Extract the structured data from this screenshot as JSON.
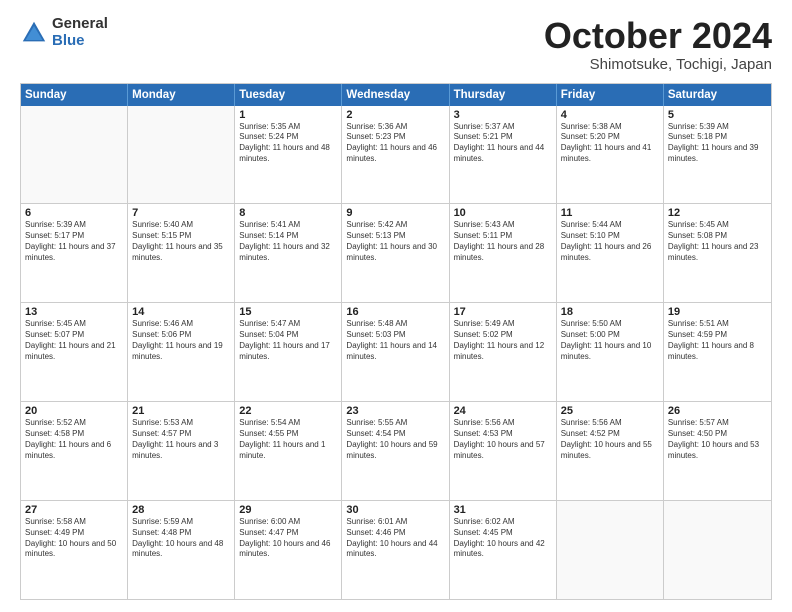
{
  "logo": {
    "general": "General",
    "blue": "Blue"
  },
  "title": {
    "month": "October 2024",
    "location": "Shimotsuke, Tochigi, Japan"
  },
  "header": {
    "days": [
      "Sunday",
      "Monday",
      "Tuesday",
      "Wednesday",
      "Thursday",
      "Friday",
      "Saturday"
    ]
  },
  "rows": [
    [
      {
        "day": "",
        "info": ""
      },
      {
        "day": "",
        "info": ""
      },
      {
        "day": "1",
        "info": "Sunrise: 5:35 AM\nSunset: 5:24 PM\nDaylight: 11 hours and 48 minutes."
      },
      {
        "day": "2",
        "info": "Sunrise: 5:36 AM\nSunset: 5:23 PM\nDaylight: 11 hours and 46 minutes."
      },
      {
        "day": "3",
        "info": "Sunrise: 5:37 AM\nSunset: 5:21 PM\nDaylight: 11 hours and 44 minutes."
      },
      {
        "day": "4",
        "info": "Sunrise: 5:38 AM\nSunset: 5:20 PM\nDaylight: 11 hours and 41 minutes."
      },
      {
        "day": "5",
        "info": "Sunrise: 5:39 AM\nSunset: 5:18 PM\nDaylight: 11 hours and 39 minutes."
      }
    ],
    [
      {
        "day": "6",
        "info": "Sunrise: 5:39 AM\nSunset: 5:17 PM\nDaylight: 11 hours and 37 minutes."
      },
      {
        "day": "7",
        "info": "Sunrise: 5:40 AM\nSunset: 5:15 PM\nDaylight: 11 hours and 35 minutes."
      },
      {
        "day": "8",
        "info": "Sunrise: 5:41 AM\nSunset: 5:14 PM\nDaylight: 11 hours and 32 minutes."
      },
      {
        "day": "9",
        "info": "Sunrise: 5:42 AM\nSunset: 5:13 PM\nDaylight: 11 hours and 30 minutes."
      },
      {
        "day": "10",
        "info": "Sunrise: 5:43 AM\nSunset: 5:11 PM\nDaylight: 11 hours and 28 minutes."
      },
      {
        "day": "11",
        "info": "Sunrise: 5:44 AM\nSunset: 5:10 PM\nDaylight: 11 hours and 26 minutes."
      },
      {
        "day": "12",
        "info": "Sunrise: 5:45 AM\nSunset: 5:08 PM\nDaylight: 11 hours and 23 minutes."
      }
    ],
    [
      {
        "day": "13",
        "info": "Sunrise: 5:45 AM\nSunset: 5:07 PM\nDaylight: 11 hours and 21 minutes."
      },
      {
        "day": "14",
        "info": "Sunrise: 5:46 AM\nSunset: 5:06 PM\nDaylight: 11 hours and 19 minutes."
      },
      {
        "day": "15",
        "info": "Sunrise: 5:47 AM\nSunset: 5:04 PM\nDaylight: 11 hours and 17 minutes."
      },
      {
        "day": "16",
        "info": "Sunrise: 5:48 AM\nSunset: 5:03 PM\nDaylight: 11 hours and 14 minutes."
      },
      {
        "day": "17",
        "info": "Sunrise: 5:49 AM\nSunset: 5:02 PM\nDaylight: 11 hours and 12 minutes."
      },
      {
        "day": "18",
        "info": "Sunrise: 5:50 AM\nSunset: 5:00 PM\nDaylight: 11 hours and 10 minutes."
      },
      {
        "day": "19",
        "info": "Sunrise: 5:51 AM\nSunset: 4:59 PM\nDaylight: 11 hours and 8 minutes."
      }
    ],
    [
      {
        "day": "20",
        "info": "Sunrise: 5:52 AM\nSunset: 4:58 PM\nDaylight: 11 hours and 6 minutes."
      },
      {
        "day": "21",
        "info": "Sunrise: 5:53 AM\nSunset: 4:57 PM\nDaylight: 11 hours and 3 minutes."
      },
      {
        "day": "22",
        "info": "Sunrise: 5:54 AM\nSunset: 4:55 PM\nDaylight: 11 hours and 1 minute."
      },
      {
        "day": "23",
        "info": "Sunrise: 5:55 AM\nSunset: 4:54 PM\nDaylight: 10 hours and 59 minutes."
      },
      {
        "day": "24",
        "info": "Sunrise: 5:56 AM\nSunset: 4:53 PM\nDaylight: 10 hours and 57 minutes."
      },
      {
        "day": "25",
        "info": "Sunrise: 5:56 AM\nSunset: 4:52 PM\nDaylight: 10 hours and 55 minutes."
      },
      {
        "day": "26",
        "info": "Sunrise: 5:57 AM\nSunset: 4:50 PM\nDaylight: 10 hours and 53 minutes."
      }
    ],
    [
      {
        "day": "27",
        "info": "Sunrise: 5:58 AM\nSunset: 4:49 PM\nDaylight: 10 hours and 50 minutes."
      },
      {
        "day": "28",
        "info": "Sunrise: 5:59 AM\nSunset: 4:48 PM\nDaylight: 10 hours and 48 minutes."
      },
      {
        "day": "29",
        "info": "Sunrise: 6:00 AM\nSunset: 4:47 PM\nDaylight: 10 hours and 46 minutes."
      },
      {
        "day": "30",
        "info": "Sunrise: 6:01 AM\nSunset: 4:46 PM\nDaylight: 10 hours and 44 minutes."
      },
      {
        "day": "31",
        "info": "Sunrise: 6:02 AM\nSunset: 4:45 PM\nDaylight: 10 hours and 42 minutes."
      },
      {
        "day": "",
        "info": ""
      },
      {
        "day": "",
        "info": ""
      }
    ]
  ]
}
